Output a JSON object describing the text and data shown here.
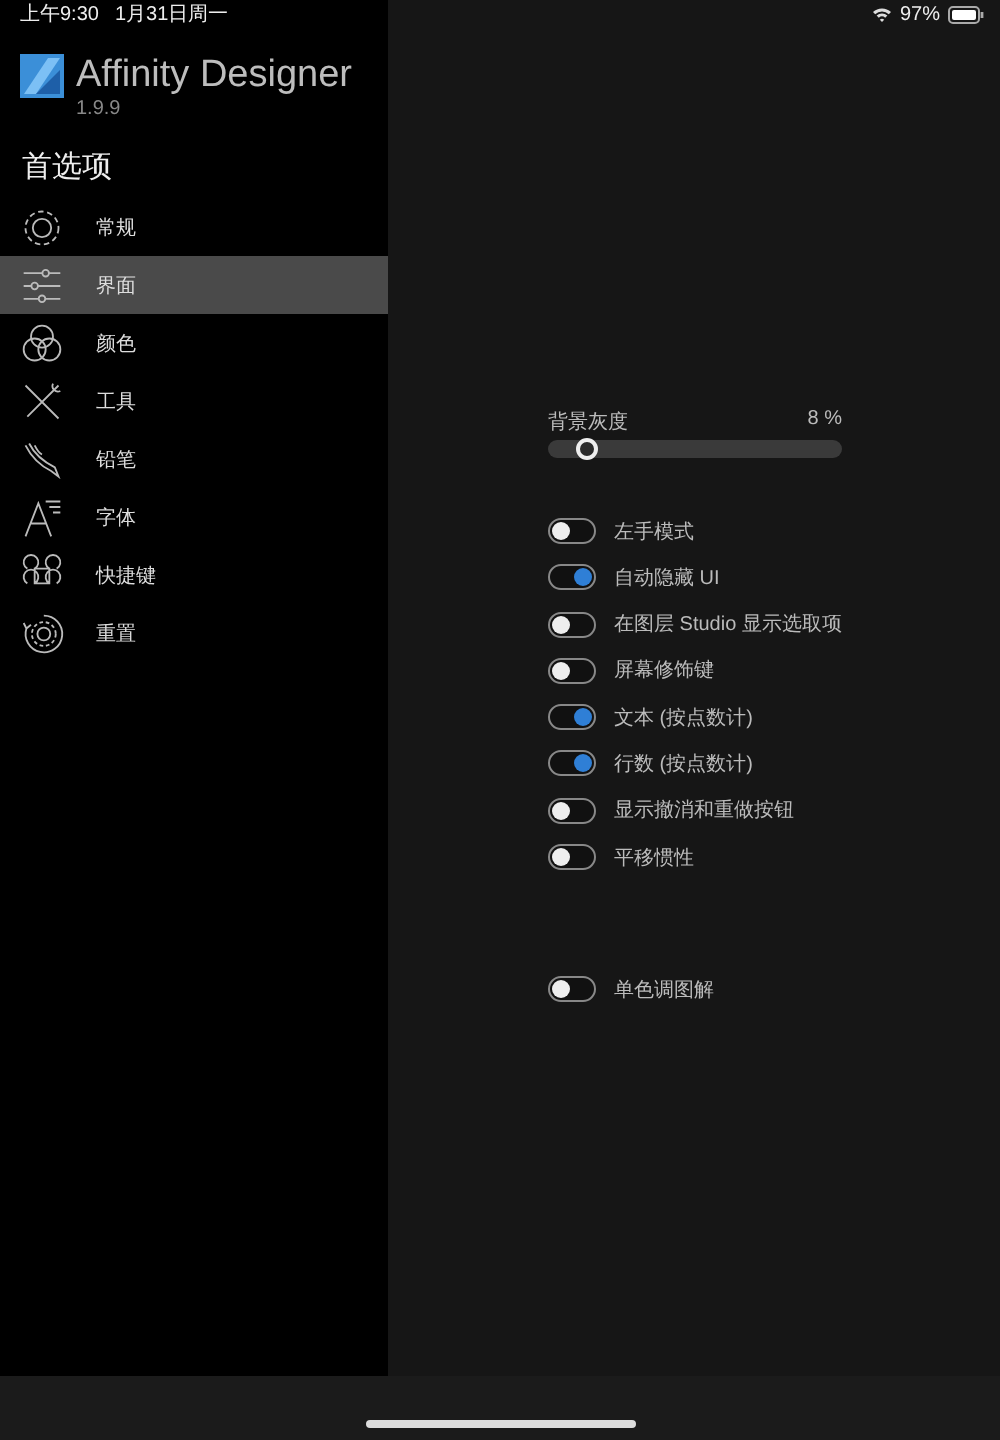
{
  "status_bar": {
    "time": "上午9:30",
    "date": "1月31日周一",
    "battery": "97%"
  },
  "app": {
    "name": "Affinity Designer",
    "version": "1.9.9"
  },
  "sidebar": {
    "title": "首选项",
    "items": [
      {
        "kind": "general",
        "label": "常规",
        "selected": false
      },
      {
        "kind": "interface",
        "label": "界面",
        "selected": true
      },
      {
        "kind": "color",
        "label": "颜色",
        "selected": false
      },
      {
        "kind": "tools",
        "label": "工具",
        "selected": false
      },
      {
        "kind": "pencil",
        "label": "铅笔",
        "selected": false
      },
      {
        "kind": "font",
        "label": "字体",
        "selected": false
      },
      {
        "kind": "shortcuts",
        "label": "快捷键",
        "selected": false
      },
      {
        "kind": "reset",
        "label": "重置",
        "selected": false
      }
    ]
  },
  "slider": {
    "label": "背景灰度",
    "reading": "8 %",
    "level": 0.08
  },
  "toggles": [
    {
      "label": "左手模式",
      "on": false
    },
    {
      "label": "自动隐藏 UI",
      "on": true
    },
    {
      "label": "在图层 Studio 显示选取项",
      "on": false
    },
    {
      "label": "屏幕修饰键",
      "on": false
    },
    {
      "label": "文本 (按点数计)",
      "on": true
    },
    {
      "label": "行数 (按点数计)",
      "on": true
    },
    {
      "label": "显示撤消和重做按钮",
      "on": false
    },
    {
      "label": "平移惯性",
      "on": false
    }
  ],
  "extra_toggles": [
    {
      "label": "单色调图解",
      "on": false
    }
  ]
}
